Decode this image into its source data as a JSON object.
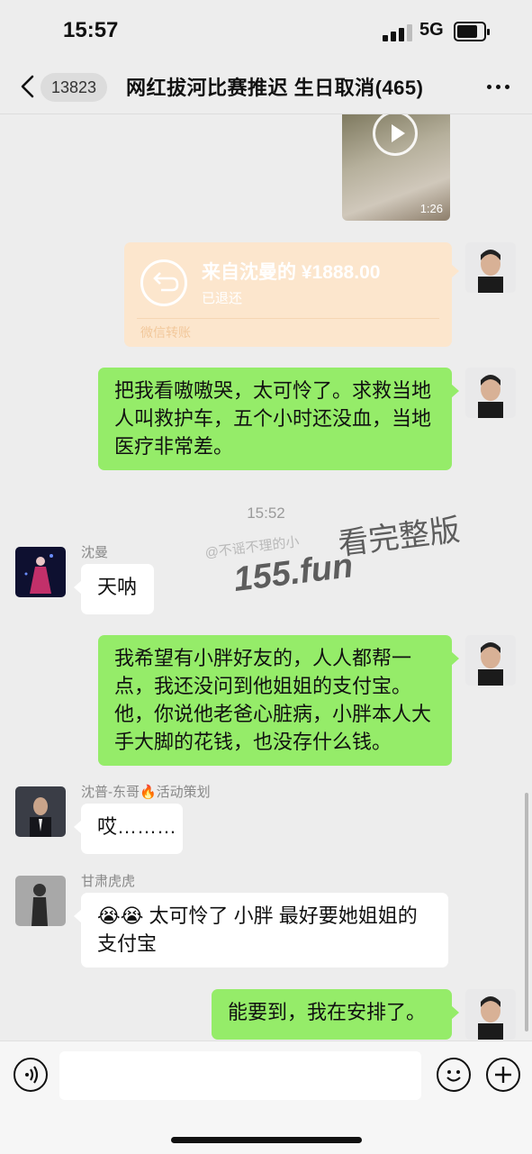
{
  "status_bar": {
    "time": "15:57",
    "network": "5G"
  },
  "header": {
    "unread_count": "13823",
    "title": "网红拔河比赛推迟 生日取消(465)"
  },
  "messages": {
    "video_duration": "1:26",
    "transfer": {
      "amount": "来自沈曼的 ¥1888.00",
      "status": "已退还",
      "label": "微信转账"
    },
    "msg1": "把我看嗷嗷哭，太可怜了。求救当地人叫救护车，五个小时还没血，当地医疗非常差。",
    "timestamp": "15:52",
    "sender_shenman": "沈曼",
    "msg2": "天呐",
    "msg3": "我希望有小胖好友的，人人都帮一点，我还没问到他姐姐的支付宝。他，你说他老爸心脏病，小胖本人大手大脚的花钱，也没存什么钱。",
    "sender_shenpu": "沈普-东哥🔥活动策划",
    "msg4": "哎………",
    "sender_gansu": "甘肃虎虎",
    "msg5_emoji": "😭😭",
    "msg5": "太可怜了  小胖  最好要她姐姐的支付宝",
    "msg6": "能要到，我在安排了。"
  },
  "watermark": {
    "small": "@不谣不理的小",
    "domain": "155.fun",
    "text": "看完整版"
  }
}
